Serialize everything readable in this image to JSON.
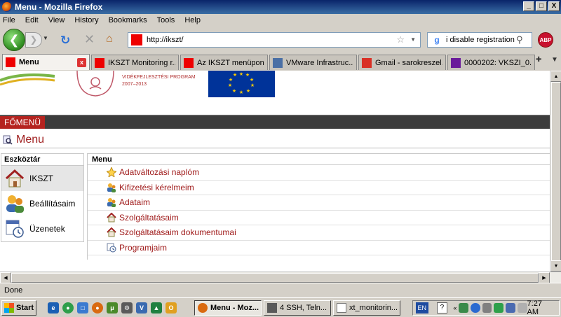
{
  "window": {
    "title": "Menu - Mozilla Firefox",
    "buttons": {
      "minimize": "_",
      "maximize": "□",
      "close": "X"
    }
  },
  "menubar": [
    "File",
    "Edit",
    "View",
    "History",
    "Bookmarks",
    "Tools",
    "Help"
  ],
  "navbar": {
    "url": "http://ikszt/",
    "search_value": "i disable registration",
    "search_engine_glyph": "g",
    "abp_label": "ABP"
  },
  "tabs": [
    {
      "label": "Menu",
      "active": true,
      "color": "#ee0000"
    },
    {
      "label": "IKSZT Monitoring r...",
      "active": false,
      "color": "#ee0000"
    },
    {
      "label": "Az IKSZT menüpon...",
      "active": false,
      "color": "#ee0000"
    },
    {
      "label": "VMware Infrastruc...",
      "active": false,
      "color": "#4a6fa5"
    },
    {
      "label": "Gmail - sarokreszel...",
      "active": false,
      "color": "#d93025"
    },
    {
      "label": "0000202: VKSZI_0...",
      "active": false,
      "color": "#6a1b9a"
    }
  ],
  "page": {
    "banner_program_line1": "VIDÉKFEJLESZTÉSI PROGRAM",
    "banner_program_line2": "2007–2013",
    "main_menu_label": "FŐMENÜ",
    "page_title": "Menu",
    "toolbox_header": "Eszköztár",
    "toolbox_items": [
      {
        "label": "IKSZT",
        "icon": "house-icon",
        "selected": true
      },
      {
        "label": "Beállításaim",
        "icon": "users-icon",
        "selected": false
      },
      {
        "label": "Üzenetek",
        "icon": "calendar-clock-icon",
        "selected": false
      }
    ],
    "menu_header": "Menu",
    "menu_items": [
      {
        "label": "Adatváltozási naplóm",
        "icon": "star-icon"
      },
      {
        "label": "Kifizetési kérelmeim",
        "icon": "users-icon"
      },
      {
        "label": "Adataim",
        "icon": "users-icon"
      },
      {
        "label": "Szolgáltatásaim",
        "icon": "house-icon"
      },
      {
        "label": "Szolgáltatásaim dokumentumai",
        "icon": "house-icon"
      },
      {
        "label": "Programjaim",
        "icon": "calendar-clock-icon"
      }
    ]
  },
  "status": "Done",
  "taskbar": {
    "start_label": "Start",
    "tasks": [
      {
        "label": "Menu - Moz...",
        "active": true
      },
      {
        "label": "4 SSH, Teln...",
        "active": false
      },
      {
        "label": "xt_monitorin...",
        "active": false
      }
    ],
    "language": "EN",
    "help": "?",
    "clock": "7:27 AM"
  },
  "colors": {
    "accent_red": "#a01c1c",
    "fomenu_red": "#b5231f",
    "eu_blue": "#003399",
    "eu_gold": "#ffcc00"
  }
}
